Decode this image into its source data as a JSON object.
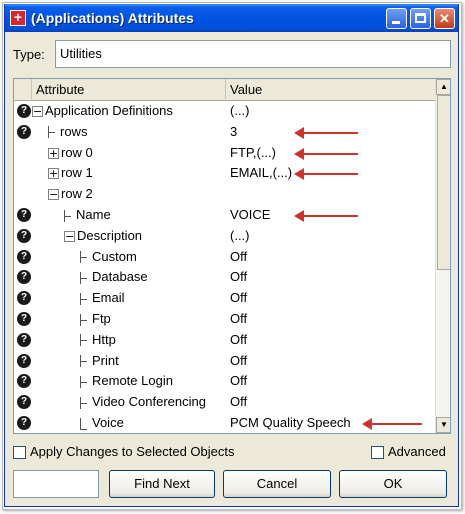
{
  "window": {
    "title": "(Applications) Attributes",
    "colors": {
      "titlebar": "#0054e3",
      "arrow": "#d0312d",
      "close": "#c23b14"
    }
  },
  "type": {
    "label": "Type:",
    "value": "Utilities"
  },
  "table": {
    "headers": {
      "attribute": "Attribute",
      "value": "Value"
    },
    "rows": [
      {
        "attr": "Application Definitions",
        "value": "(...)",
        "help": true,
        "toggle": "minus"
      },
      {
        "attr": "rows",
        "value": "3",
        "help": true,
        "toggle": "tee",
        "annotated": true
      },
      {
        "attr": "row 0",
        "value": "FTP,(...)",
        "help": false,
        "toggle": "plus",
        "annotated": true
      },
      {
        "attr": "row 1",
        "value": "EMAIL,(...)",
        "help": false,
        "toggle": "plus",
        "annotated": true
      },
      {
        "attr": "row 2",
        "value": "",
        "help": false,
        "toggle": "minus"
      },
      {
        "attr": "Name",
        "value": "VOICE",
        "help": true,
        "toggle": "tee",
        "annotated": true
      },
      {
        "attr": "Description",
        "value": "(...)",
        "help": true,
        "toggle": "minus"
      },
      {
        "attr": "Custom",
        "value": "Off",
        "help": true,
        "toggle": "tee"
      },
      {
        "attr": "Database",
        "value": "Off",
        "help": true,
        "toggle": "tee"
      },
      {
        "attr": "Email",
        "value": "Off",
        "help": true,
        "toggle": "tee"
      },
      {
        "attr": "Ftp",
        "value": "Off",
        "help": true,
        "toggle": "tee"
      },
      {
        "attr": "Http",
        "value": "Off",
        "help": true,
        "toggle": "tee"
      },
      {
        "attr": "Print",
        "value": "Off",
        "help": true,
        "toggle": "tee"
      },
      {
        "attr": "Remote Login",
        "value": "Off",
        "help": true,
        "toggle": "tee"
      },
      {
        "attr": "Video Conferencing",
        "value": "Off",
        "help": true,
        "toggle": "tee"
      },
      {
        "attr": "Voice",
        "value": "PCM Quality Speech",
        "help": true,
        "toggle": "ell",
        "annotated": true
      }
    ]
  },
  "options": {
    "apply_label": "Apply Changes to Selected Objects",
    "advanced_label": "Advanced"
  },
  "buttons": {
    "find_next": "Find Next",
    "cancel": "Cancel",
    "ok": "OK"
  },
  "icons": {
    "app": "plus-square-icon",
    "help": "question-icon",
    "expand": "plus-box-icon",
    "collapse": "minus-box-icon",
    "annotation": "red-arrow-icon"
  }
}
